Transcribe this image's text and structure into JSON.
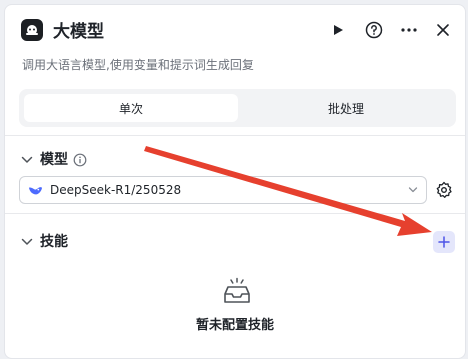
{
  "header": {
    "title": "大模型",
    "description": "调用大语言模型,使用变量和提示词生成回复",
    "icons": [
      "robot-icon",
      "play-icon",
      "help-icon",
      "more-icon",
      "close-icon"
    ]
  },
  "tabs": [
    {
      "label": "单次",
      "active": true
    },
    {
      "label": "批处理",
      "active": false
    }
  ],
  "model_section": {
    "title": "模型",
    "selected_model": "DeepSeek-R1/250528"
  },
  "skills_section": {
    "title": "技能",
    "empty_text": "暂未配置技能"
  },
  "colors": {
    "accent_bg": "#e4e6fb",
    "accent": "#4d53e8",
    "annotation_arrow": "#e6402e"
  }
}
